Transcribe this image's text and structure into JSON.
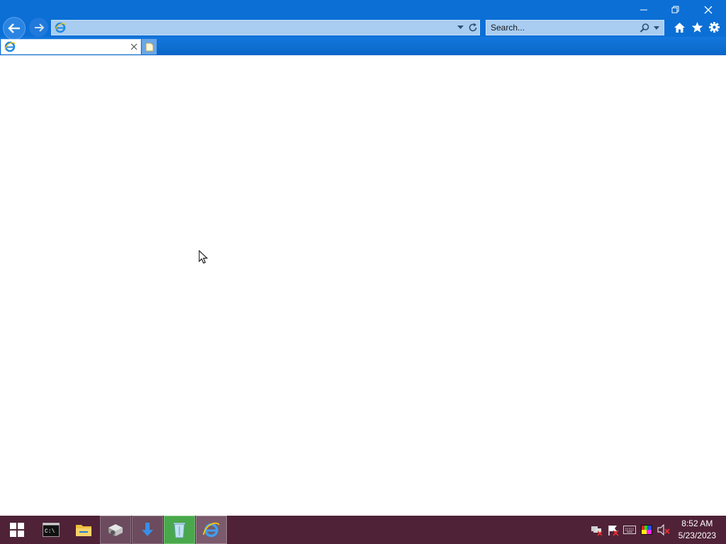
{
  "browser": {
    "address_value": "",
    "search_placeholder": "Search...",
    "tab_title": ""
  },
  "icons": {
    "back": "back-arrow-icon",
    "forward": "forward-arrow-icon",
    "ie": "ie-logo-icon",
    "dropdown": "chevron-down-icon",
    "refresh": "refresh-icon",
    "search": "search-icon",
    "home": "home-icon",
    "favorites": "star-icon",
    "tools": "gear-icon"
  },
  "taskbar": {
    "time": "8:52 AM",
    "date": "5/23/2023",
    "apps": [
      "command-prompt",
      "file-explorer",
      "package-manager",
      "download-manager",
      "recycle-bin",
      "internet-explorer"
    ]
  },
  "colors": {
    "titlebar": "#0b6fd6",
    "taskbar": "#4f2238",
    "address_bg": "#a9cdf1"
  }
}
